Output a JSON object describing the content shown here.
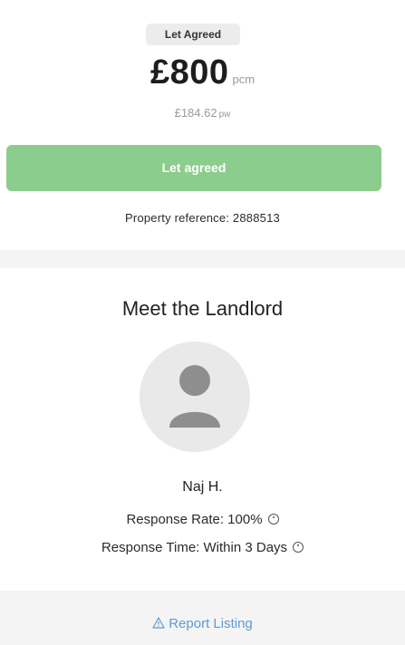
{
  "price_card": {
    "badge": "Let Agreed",
    "price": "£800",
    "price_unit": "pcm",
    "weekly_price": "£184.62",
    "weekly_unit": "pw",
    "button_label": "Let agreed",
    "reference": "Property reference: 2888513"
  },
  "landlord": {
    "title": "Meet the Landlord",
    "name": "Naj H.",
    "response_rate": "Response Rate: 100%",
    "response_time": "Response Time: Within 3 Days"
  },
  "footer": {
    "report_label": "Report Listing"
  },
  "icons": {
    "avatar": "person-placeholder-icon",
    "info": "info-icon",
    "warning": "warning-triangle-icon"
  },
  "colors": {
    "button": "#8ccd8d",
    "link": "#5b9bd5",
    "badge_bg": "#ececec"
  }
}
